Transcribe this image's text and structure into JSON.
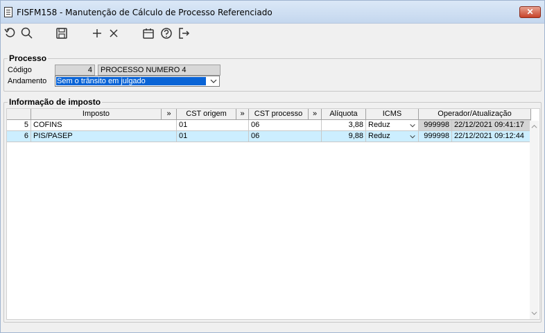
{
  "window": {
    "title": "FISFM158 - Manutenção de Cálculo de Processo Referenciado",
    "close_label": "✕"
  },
  "processo": {
    "legend": "Processo",
    "codigo_label": "Código",
    "codigo_value": "4",
    "nome_value": "PROCESSO NUMERO 4",
    "andamento_label": "Andamento",
    "andamento_value": "Sem o trânsito em julgado"
  },
  "imposto": {
    "legend": "Informação de imposto",
    "headers": {
      "imposto": "Imposto",
      "expand": "»",
      "cst_origem": "CST origem",
      "cst_processo": "CST processo",
      "aliquota": "Alíquota",
      "icms": "ICMS",
      "operador": "Operador/Atualização"
    },
    "rows": [
      {
        "id": "5",
        "imposto": "COFINS",
        "cst_origem": "01",
        "cst_processo": "06",
        "aliquota": "3,88",
        "icms": "Reduz",
        "operador": "999998",
        "data": "22/12/2021 09:41:17"
      },
      {
        "id": "6",
        "imposto": "PIS/PASEP",
        "cst_origem": "01",
        "cst_processo": "06",
        "aliquota": "9,88",
        "icms": "Reduz",
        "operador": "999998",
        "data": "22/12/2021 09:12:44"
      }
    ]
  },
  "toolbar_icons": [
    "undo-icon",
    "search-icon",
    "save-icon",
    "add-icon",
    "delete-icon",
    "calendar-icon",
    "help-icon",
    "exit-icon"
  ]
}
